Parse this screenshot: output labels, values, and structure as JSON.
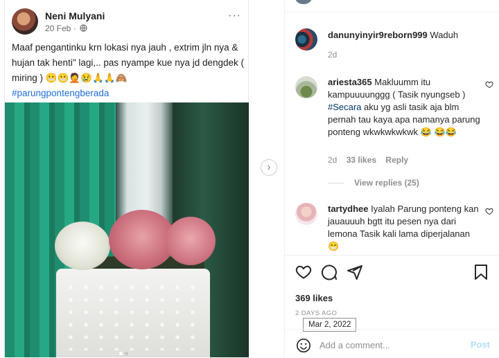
{
  "fb_post": {
    "author": "Neni Mulyani",
    "time": "20 Feb ·",
    "more": "···",
    "text": "Maaf pengantinku krn lokasi nya jauh , extrim  jln nya & hujan tak henti\" lagi,.. pas nyampe kue nya jd dengdek ( miring ) 😬😬🤦😢🙏🙏🙈",
    "hashtag": "#parungpontengberada"
  },
  "comments": [
    {
      "user": "danunyinyir9reborn999",
      "text": "Waduh",
      "time": "2d"
    },
    {
      "user": "ariesta365",
      "text_before": "Makluumm itu kampuuuunggg ( Tasik nyungseb ) ",
      "tag": "#Secara",
      "text_after": " aku yg asli tasik aja blm pernah tau kaya apa namanya parung ponteng wkwkwkwkwk 😂 😂😂",
      "time": "2d",
      "likes": "33 likes",
      "reply": "Reply",
      "view_replies": "View replies (25)"
    },
    {
      "user": "tartydhee",
      "text": "Iyalah Parung ponteng kan jauauuuh bgtt itu pesen nya dari lemona Tasik kali lama diperjalanan 😁"
    }
  ],
  "likes_count": "369 likes",
  "post_date": "2 DAYS AGO",
  "date_tooltip": "Mar 2, 2022",
  "add_comment": {
    "placeholder": "Add a comment...",
    "post_label": "Post"
  },
  "icons": {
    "like": "heart-icon",
    "comment": "comment-icon",
    "share": "share-icon",
    "save": "bookmark-icon",
    "emoji": "emoji-icon",
    "next": "chevron-right-icon"
  },
  "colors": {
    "link": "#00376b",
    "post_button": "#b2dffc",
    "hashtag": "#216fdb"
  }
}
